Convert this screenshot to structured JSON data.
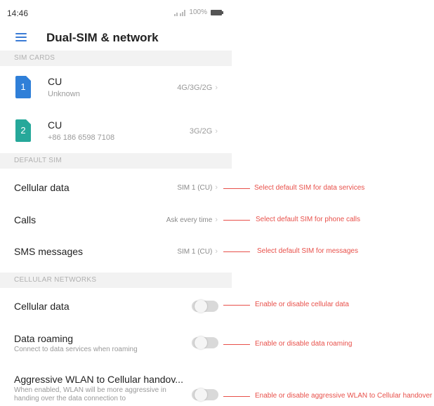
{
  "status_bar": {
    "time": "14:46",
    "battery": "100%"
  },
  "app_bar": {
    "title": "Dual-SIM & network"
  },
  "sections": {
    "sim_cards": "SIM CARDS",
    "default_sim": "DEFAULT SIM",
    "cellular_networks": "CELLULAR NETWORKS"
  },
  "sims": [
    {
      "slot": "1",
      "name": "CU",
      "detail": "Unknown",
      "network": "4G/3G/2G",
      "color": "#2f7fd8"
    },
    {
      "slot": "2",
      "name": "CU",
      "detail": "+86 186 6598 7108",
      "network": "3G/2G",
      "color": "#26a89a"
    }
  ],
  "default_sim": [
    {
      "title": "Cellular data",
      "value": "SIM 1 (CU)"
    },
    {
      "title": "Calls",
      "value": "Ask every time"
    },
    {
      "title": "SMS messages",
      "value": "SIM 1 (CU)"
    }
  ],
  "cellular": [
    {
      "title": "Cellular data",
      "subtitle": "",
      "enabled": false
    },
    {
      "title": "Data roaming",
      "subtitle": "Connect to data services when roaming",
      "enabled": false
    },
    {
      "title": "Aggressive WLAN to Cellular handov...",
      "subtitle": "When enabled, WLAN will be more aggressive in handing over the data connection to",
      "enabled": false
    }
  ],
  "callouts": [
    "Select default SIM for data services",
    "Select default SIM for phone calls",
    "Select default SIM for messages",
    "Enable or disable cellular data",
    "Enable or disable data roaming",
    "Enable or disable aggressive WLAN to Cellular handover"
  ],
  "colors": {
    "accent": "#3a7bd5",
    "callout": "#e8504a"
  }
}
